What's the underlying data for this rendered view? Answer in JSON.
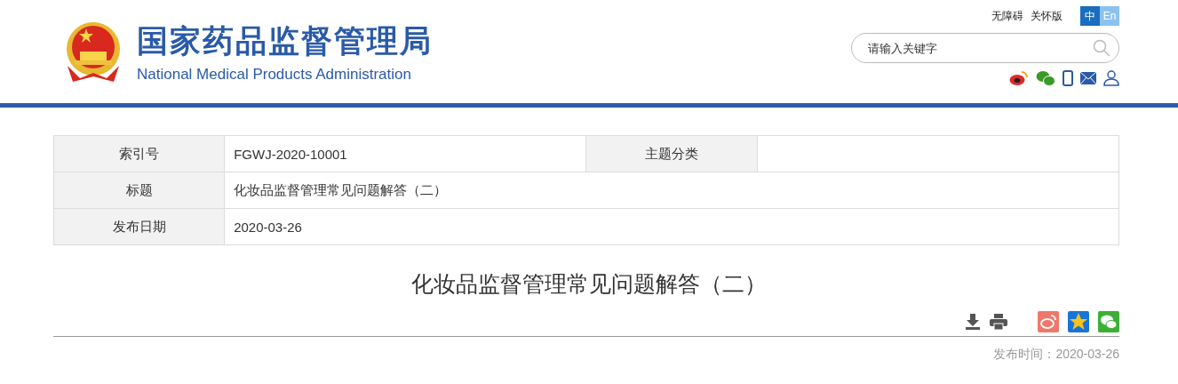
{
  "header": {
    "title_cn": "国家药品监督管理局",
    "title_en": "National Medical Products Administration",
    "links": [
      "无障碍",
      "关怀版"
    ],
    "languages": [
      {
        "label": "中",
        "selected": true
      },
      {
        "label": "En",
        "selected": false
      }
    ],
    "search": {
      "placeholder": "请输入关键字"
    }
  },
  "info_table": {
    "rows": [
      {
        "cells": [
          {
            "label": "索引号",
            "value": "FGWJ-2020-10001"
          },
          {
            "label": "主题分类"
          }
        ]
      },
      {
        "cells": [
          {
            "label": "标题",
            "value": "化妆品监督管理常见问题解答（二）"
          }
        ]
      },
      {
        "cells": [
          {
            "label": "发布日期",
            "value": "2020-03-26"
          }
        ]
      }
    ]
  },
  "article": {
    "title": "化妆品监督管理常见问题解答（二）",
    "published_label": "发布时间：",
    "published": "2020-03-26"
  }
}
